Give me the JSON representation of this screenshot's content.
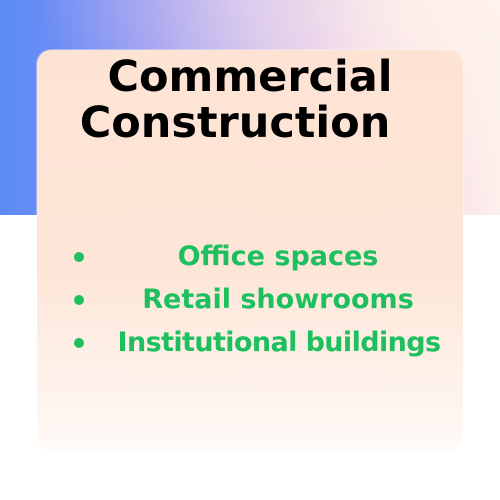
{
  "card": {
    "title_line1": "Commercial",
    "title_line2": "Construction",
    "items": [
      {
        "label": "Office spaces"
      },
      {
        "label": "Retail showrooms"
      },
      {
        "label": "Institutional buildings"
      }
    ]
  },
  "colors": {
    "accent_green": "#1dbf5f",
    "title_text": "#000000",
    "card_background": "#fde3d3",
    "gradient_blue": "#5b8cf6"
  }
}
